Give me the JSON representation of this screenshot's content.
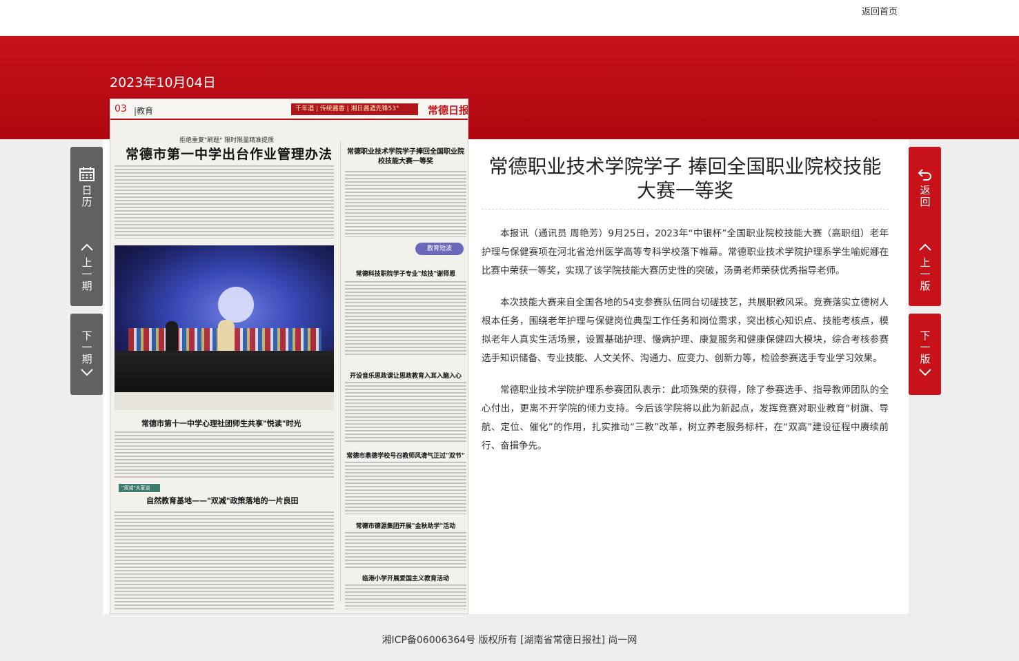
{
  "header": {
    "home_link": "返回首页"
  },
  "edition": {
    "date": "2023年10月04日",
    "page_number": "03",
    "section": "|教育",
    "logo": "常德日报",
    "ad_text": "千年酒 | 传统酱香 | 湘日酱酒先锋53°",
    "kicker": "拒绝重复\"刷题\" 限时限量精准提质",
    "headline_main": "常德市第一中学出台作业管理办法",
    "headline_right": "常德职业技术学院学子捧回全国职业院校技能大赛一等奖",
    "headline_mid": "常德市第十一中学心理社团师生共享\"悦读\"时光",
    "column_tag": "\"双减\"大家谈",
    "headline_bottom": "自然教育基地——\"双减\"政策落地的一片良田",
    "brief_tag": "教育短波",
    "brief_items": [
      "常德科技职院学子专业\"炫技\"谢师恩",
      "开设音乐思政课让思政教育入耳入脑入心",
      "常德市鼎德学校号召教师风清气正过\"双节\"",
      "常德市德源集团开展\"金秋助学\"活动",
      "临港小学开展爱国主义教育活动"
    ]
  },
  "nav_left": [
    {
      "label": "日历",
      "icon": "calendar-icon"
    },
    {
      "label": "上一期",
      "icon": "chevron-up-icon"
    },
    {
      "label": "下一期",
      "icon": "chevron-down-icon"
    }
  ],
  "nav_right": [
    {
      "label": "返回",
      "icon": "return-arrow-icon"
    },
    {
      "label": "上一版",
      "icon": "chevron-up-icon"
    },
    {
      "label": "下一版",
      "icon": "chevron-down-icon"
    }
  ],
  "article": {
    "title": "常德职业技术学院学子 捧回全国职业院校技能大赛一等奖",
    "paragraphs": [
      "本报讯（通讯员 周艳芳）9月25日，2023年“中银杯”全国职业院校技能大赛（高职组）老年护理与保健赛项在河北省沧州医学高等专科学校落下帷幕。常德职业技术学院护理系学生喻妮娜在比赛中荣获一等奖，实现了该学院技能大赛历史性的突破，汤勇老师荣获优秀指导老师。",
      "本次技能大赛来自全国各地的54支参赛队伍同台切磋技艺，共展职教风采。竞赛落实立德树人根本任务，围绕老年护理与保健岗位典型工作任务和岗位需求，突出核心知识点、技能考核点，模拟老年人真实生活场景，设置基础护理、慢病护理、康复服务和健康保健四大模块，综合考核参赛选手知识储备、专业技能、人文关怀、沟通力、应变力、创新力等，检验参赛选手专业学习效果。",
      "常德职业技术学院护理系参赛团队表示：此项殊荣的获得，除了参赛选手、指导教师团队的全心付出，更离不开学院的倾力支持。今后该学院将以此为新起点，发挥竞赛对职业教育“树旗、导航、定位、催化”的作用，扎实推动“三教”改革，树立养老服务标杆，在“双高”建设征程中赓续前行、奋揖争先。"
    ]
  },
  "footer": {
    "text": "湘ICP备06006364号 版权所有 [湖南省常德日报社] 尚一网"
  },
  "colors": {
    "brand_red": "#c4121b",
    "nav_gray": "#616161",
    "nav_red": "#c8121a"
  }
}
